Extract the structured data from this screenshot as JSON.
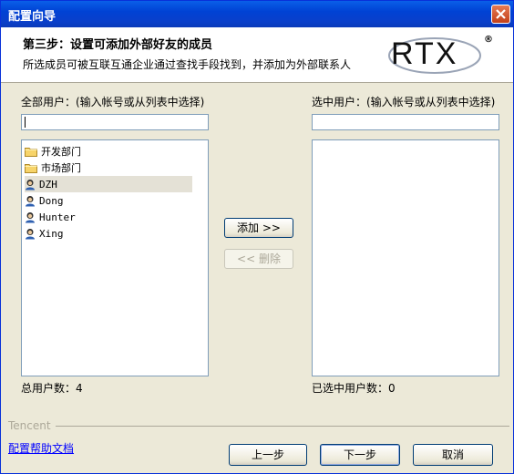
{
  "window": {
    "title": "配置向导"
  },
  "header": {
    "step_title": "第三步：设置可添加外部好友的成员",
    "step_desc": "所选成员可被互联互通企业通过查找手段找到，并添加为外部联系人",
    "logo_text": "RTX",
    "logo_reg": "®"
  },
  "left_panel": {
    "label": "全部用户：(输入帐号或从列表中选择)",
    "search_value": "",
    "items": [
      {
        "type": "folder",
        "icon": "folder-icon",
        "label": "开发部门"
      },
      {
        "type": "folder",
        "icon": "folder-icon",
        "label": "市场部门"
      },
      {
        "type": "user",
        "icon": "user-icon",
        "label": "DZH",
        "selected": true
      },
      {
        "type": "user",
        "icon": "user-icon",
        "label": "Dong"
      },
      {
        "type": "user",
        "icon": "user-icon",
        "label": "Hunter"
      },
      {
        "type": "user",
        "icon": "user-icon",
        "label": "Xing"
      }
    ],
    "total_label": "总用户数：4"
  },
  "right_panel": {
    "label": "选中用户：(输入帐号或从列表中选择)",
    "search_value": "",
    "total_label": "已选中用户数：0"
  },
  "middle_buttons": {
    "add": "添加 >>",
    "remove": "<< 删除"
  },
  "footer": {
    "brand": "Tencent",
    "help_link": "配置帮助文档",
    "prev": "上一步",
    "next": "下一步",
    "cancel": "取消"
  },
  "colors": {
    "titlebar": "#0a50e0",
    "close_button": "#d4502a",
    "link": "#0000ff",
    "dialog_bg": "#ece9d8"
  }
}
